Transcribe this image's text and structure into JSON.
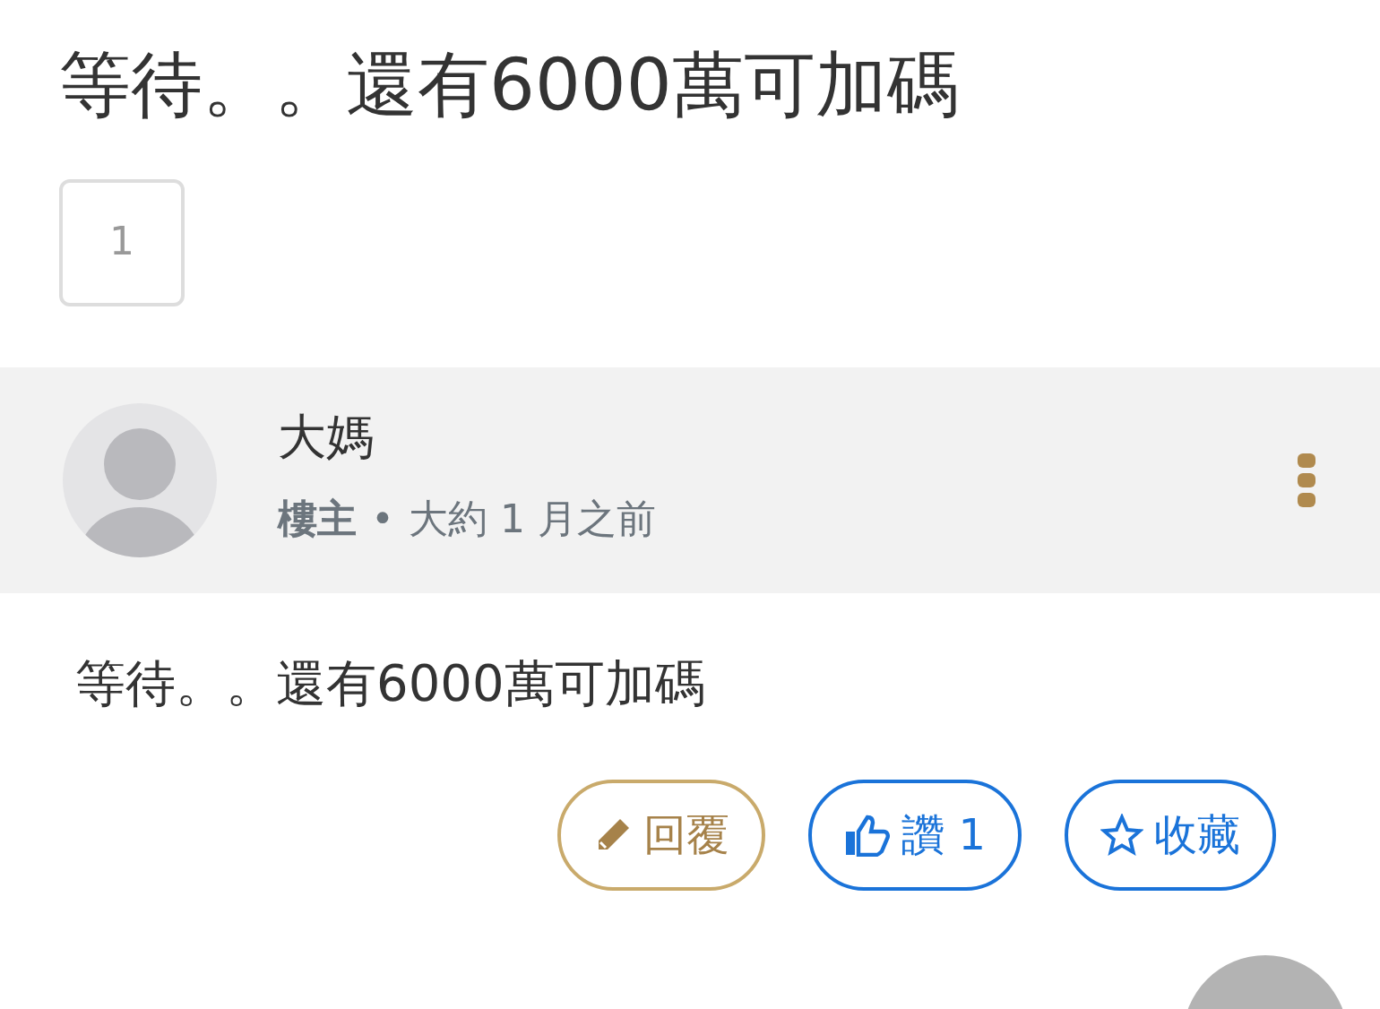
{
  "title": "等待。。還有6000萬可加碼",
  "pagination": [
    {
      "label": "1"
    }
  ],
  "post": {
    "author": "大媽",
    "role": "樓主",
    "separator": "•",
    "time": "大約 1 月之前",
    "body": "等待。。還有6000萬可加碼"
  },
  "actions": [
    {
      "kind": "reply",
      "label": "回覆"
    },
    {
      "kind": "like",
      "label": "讚 1"
    },
    {
      "kind": "favorite",
      "label": "收藏"
    }
  ]
}
